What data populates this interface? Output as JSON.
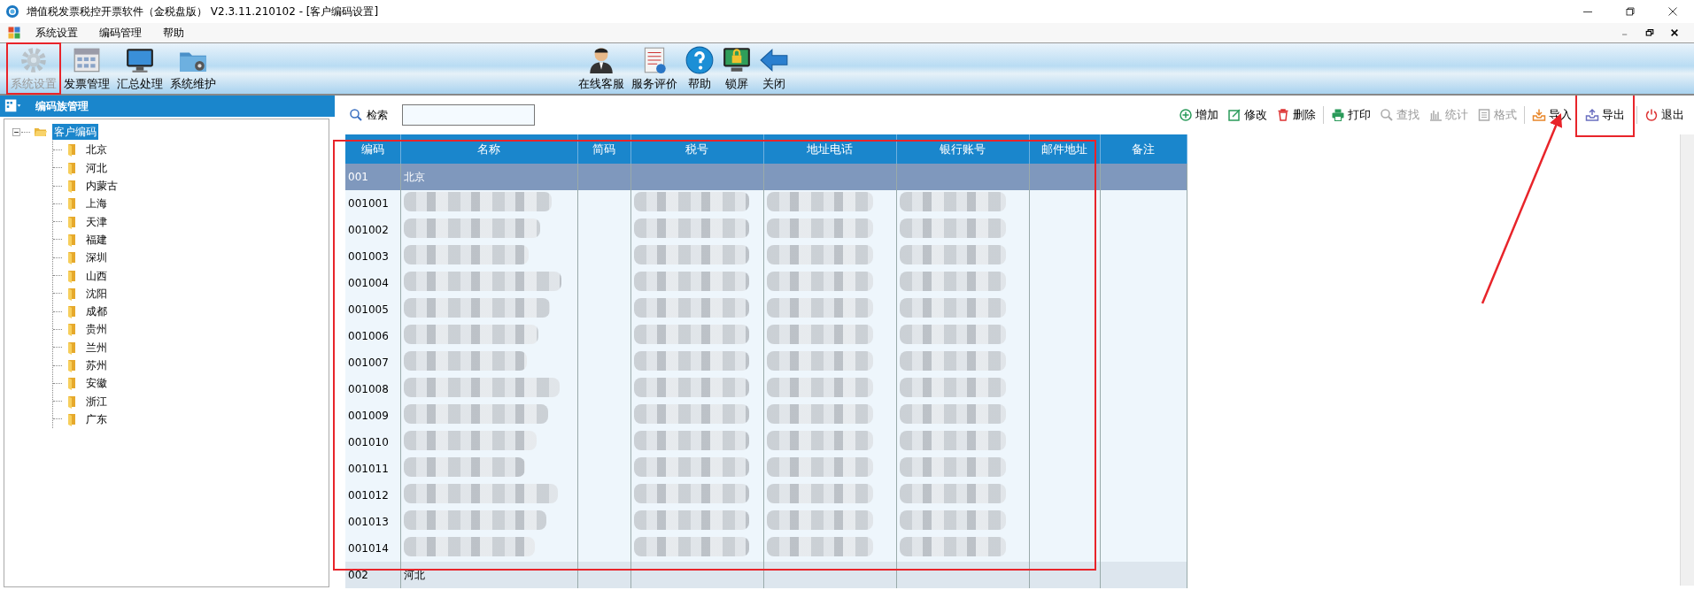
{
  "window": {
    "title": "增值税发票税控开票软件（金税盘版） V2.3.11.210102 - [客户编码设置]"
  },
  "menu": [
    "系统设置",
    "编码管理",
    "帮助"
  ],
  "toolbar_left": [
    {
      "label": "系统设置",
      "disabled": true,
      "highlighted": true
    },
    {
      "label": "发票管理",
      "disabled": false,
      "highlighted": false
    },
    {
      "label": "汇总处理",
      "disabled": false,
      "highlighted": false
    },
    {
      "label": "系统维护",
      "disabled": false,
      "highlighted": false
    }
  ],
  "toolbar_right": [
    {
      "label": "在线客服"
    },
    {
      "label": "服务评价"
    },
    {
      "label": "帮助"
    },
    {
      "label": "锁屏"
    },
    {
      "label": "关闭"
    }
  ],
  "sidebar": {
    "title": "编码族管理",
    "tree": [
      {
        "label": "客户编码",
        "selected": true,
        "expanded": true,
        "children": [
          {
            "label": "北京",
            "selected": false
          },
          {
            "label": "河北",
            "selected": false
          },
          {
            "label": "内蒙古",
            "selected": false
          },
          {
            "label": "上海",
            "selected": false
          },
          {
            "label": "天津",
            "selected": false
          },
          {
            "label": "福建",
            "selected": false
          },
          {
            "label": "深圳",
            "selected": false
          },
          {
            "label": "山西",
            "selected": false
          },
          {
            "label": "沈阳",
            "selected": false
          },
          {
            "label": "成都",
            "selected": false
          },
          {
            "label": "贵州",
            "selected": false
          },
          {
            "label": "兰州",
            "selected": false
          },
          {
            "label": "苏州",
            "selected": false
          },
          {
            "label": "安徽",
            "selected": false
          },
          {
            "label": "浙江",
            "selected": false
          },
          {
            "label": "广东",
            "selected": false
          }
        ]
      }
    ]
  },
  "search": {
    "label": "检索"
  },
  "actions": [
    {
      "label": "增加",
      "disabled": false,
      "highlighted": false
    },
    {
      "label": "修改",
      "disabled": false,
      "highlighted": false
    },
    {
      "label": "删除",
      "disabled": false,
      "highlighted": false
    },
    {
      "label": "打印",
      "disabled": false,
      "highlighted": false
    },
    {
      "label": "查找",
      "disabled": true,
      "highlighted": false
    },
    {
      "label": "统计",
      "disabled": true,
      "highlighted": false
    },
    {
      "label": "格式",
      "disabled": true,
      "highlighted": false
    },
    {
      "label": "导入",
      "disabled": false,
      "highlighted": false
    },
    {
      "label": "导出",
      "disabled": false,
      "highlighted": true
    },
    {
      "label": "退出",
      "disabled": false,
      "highlighted": false
    }
  ],
  "table": {
    "highlighted": true,
    "columns": [
      "编码",
      "名称",
      "简码",
      "税号",
      "地址电话",
      "银行账号",
      "邮件地址",
      "备注"
    ],
    "rows": [
      {
        "kind": "group",
        "code": "001",
        "name": "北京",
        "selected": true
      },
      {
        "kind": "record",
        "code": "001001",
        "blurred": true
      },
      {
        "kind": "record",
        "code": "001002",
        "blurred": true
      },
      {
        "kind": "record",
        "code": "001003",
        "blurred": true
      },
      {
        "kind": "record",
        "code": "001004",
        "blurred": true
      },
      {
        "kind": "record",
        "code": "001005",
        "blurred": true
      },
      {
        "kind": "record",
        "code": "001006",
        "blurred": true
      },
      {
        "kind": "record",
        "code": "001007",
        "blurred": true
      },
      {
        "kind": "record",
        "code": "001008",
        "blurred": true
      },
      {
        "kind": "record",
        "code": "001009",
        "blurred": true
      },
      {
        "kind": "record",
        "code": "001010",
        "blurred": true
      },
      {
        "kind": "record",
        "code": "001011",
        "blurred": true
      },
      {
        "kind": "record",
        "code": "001012",
        "blurred": true
      },
      {
        "kind": "record",
        "code": "001013",
        "blurred": true
      },
      {
        "kind": "record",
        "code": "001014",
        "blurred": true
      },
      {
        "kind": "group",
        "code": "002",
        "name": "河北",
        "selected": false
      }
    ]
  },
  "annotation_arrow": true
}
